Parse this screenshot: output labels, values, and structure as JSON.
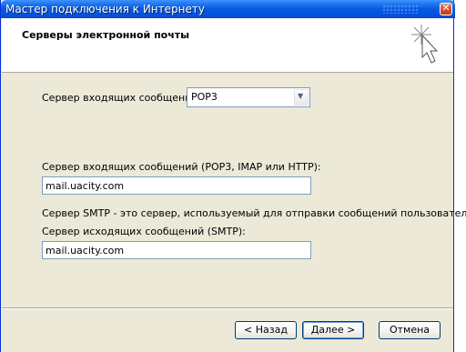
{
  "window": {
    "title": "Мастер подключения к Интернету",
    "close_glyph": "✕"
  },
  "header": {
    "title": "Серверы электронной почты",
    "icon": "wizard-cursor-icon"
  },
  "incoming_type": {
    "label": "Сервер входящих сообщений:",
    "selected": "POP3"
  },
  "incoming_server": {
    "label": "Сервер входящих сообщений (POP3, IMAP или HTTP):",
    "value": "mail.uacity.com"
  },
  "smtp_note": "Сервер SMTP - это сервер, используемый для отправки сообщений  пользователя.",
  "outgoing_server": {
    "label": "Сервер исходящих сообщений (SMTP):",
    "value": "mail.uacity.com"
  },
  "buttons": {
    "back": "< Назад",
    "next": "Далее >",
    "cancel": "Отмена"
  }
}
